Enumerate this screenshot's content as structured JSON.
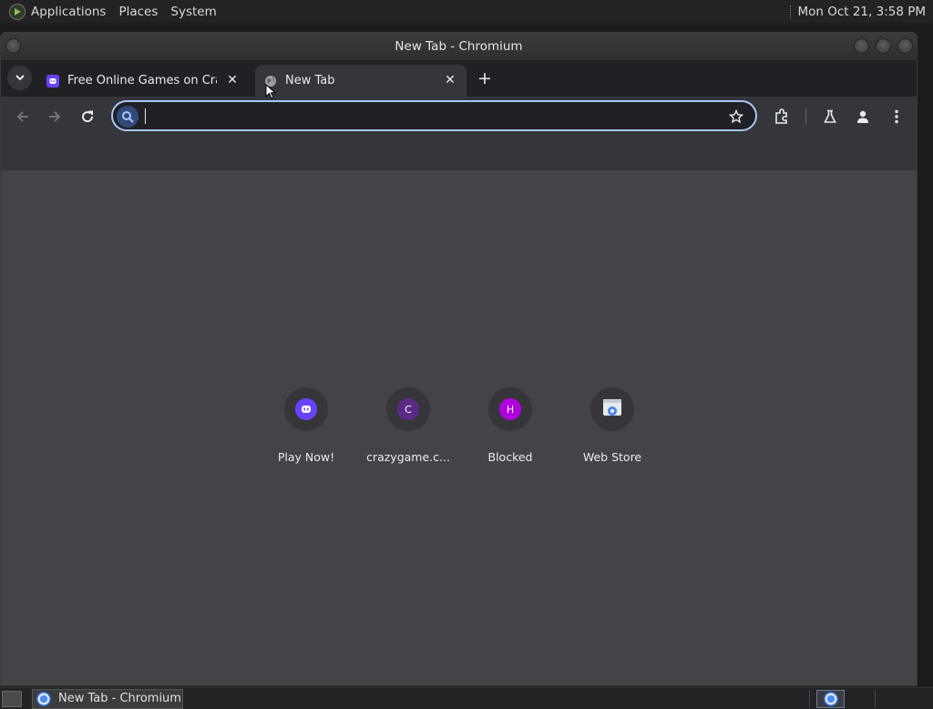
{
  "system_panel": {
    "menus": [
      "Applications",
      "Places",
      "System"
    ],
    "clock": "Mon Oct 21,  3:58 PM"
  },
  "window": {
    "title": "New Tab - Chromium"
  },
  "tabs": [
    {
      "title": "Free Online Games on CrazyGames",
      "favicon": "crazygames-icon",
      "active": false
    },
    {
      "title": "New Tab",
      "favicon": "globe-icon",
      "active": true
    }
  ],
  "omnibox": {
    "value": "",
    "placeholder": ""
  },
  "shortcuts": [
    {
      "label": "Play Now!",
      "icon": "crazygames-icon",
      "letter": "",
      "color": "#6842ff"
    },
    {
      "label": "crazygame.c...",
      "icon": "letter-icon",
      "letter": "C",
      "color": "#5b2a86"
    },
    {
      "label": "Blocked",
      "icon": "letter-icon",
      "letter": "H",
      "color": "#b000e0"
    },
    {
      "label": "Web Store",
      "icon": "web-store-icon",
      "letter": "",
      "color": "#4285f4"
    }
  ],
  "taskbar": {
    "item_label": "New Tab - Chromium"
  },
  "colors": {
    "omnibox_focus": "#a8c7fa",
    "ntp_background": "#444448",
    "toolbar": "#35363a",
    "tabstrip": "#202124"
  }
}
